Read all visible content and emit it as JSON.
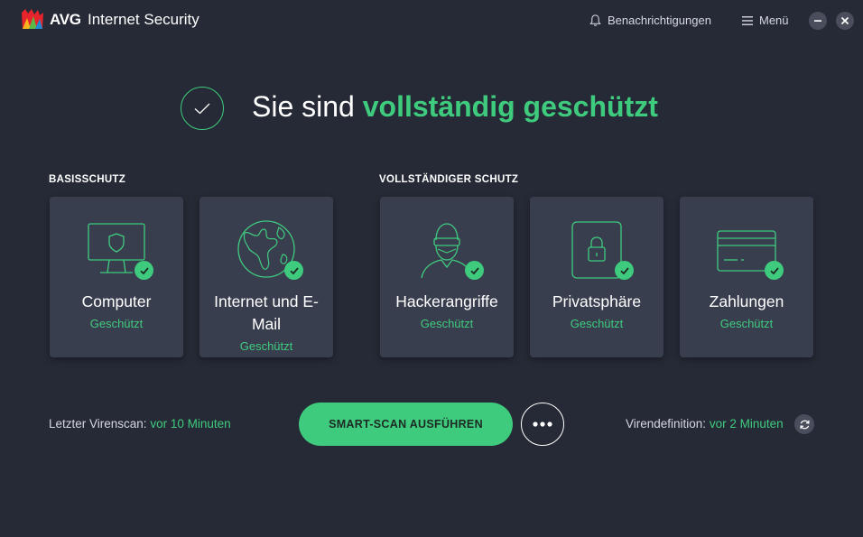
{
  "app": {
    "brand": "AVG",
    "product": "Internet Security"
  },
  "header": {
    "notifications_label": "Benachrichtigungen",
    "menu_label": "Menü"
  },
  "hero": {
    "prefix": "Sie sind",
    "highlight": "vollständig geschützt"
  },
  "sections": {
    "basic": "BASISSCHUTZ",
    "full": "VOLLSTÄNDIGER SCHUTZ"
  },
  "cards": [
    {
      "title": "Computer",
      "status": "Geschützt",
      "icon": "monitor-shield-icon"
    },
    {
      "title": "Internet und E-Mail",
      "status": "Geschützt",
      "icon": "globe-icon"
    },
    {
      "title": "Hackerangriffe",
      "status": "Geschützt",
      "icon": "hacker-icon"
    },
    {
      "title": "Privatsphäre",
      "status": "Geschützt",
      "icon": "phone-lock-icon"
    },
    {
      "title": "Zahlungen",
      "status": "Geschützt",
      "icon": "credit-card-icon"
    }
  ],
  "bottom": {
    "last_scan_label": "Letzter Virenscan:",
    "last_scan_value": "vor 10 Minuten",
    "scan_button": "SMART-SCAN AUSFÜHREN",
    "virus_def_label": "Virendefinition:",
    "virus_def_value": "vor 2 Minuten"
  },
  "colors": {
    "accent": "#3fcb7e",
    "background": "#262a36",
    "card": "#393e4f"
  }
}
